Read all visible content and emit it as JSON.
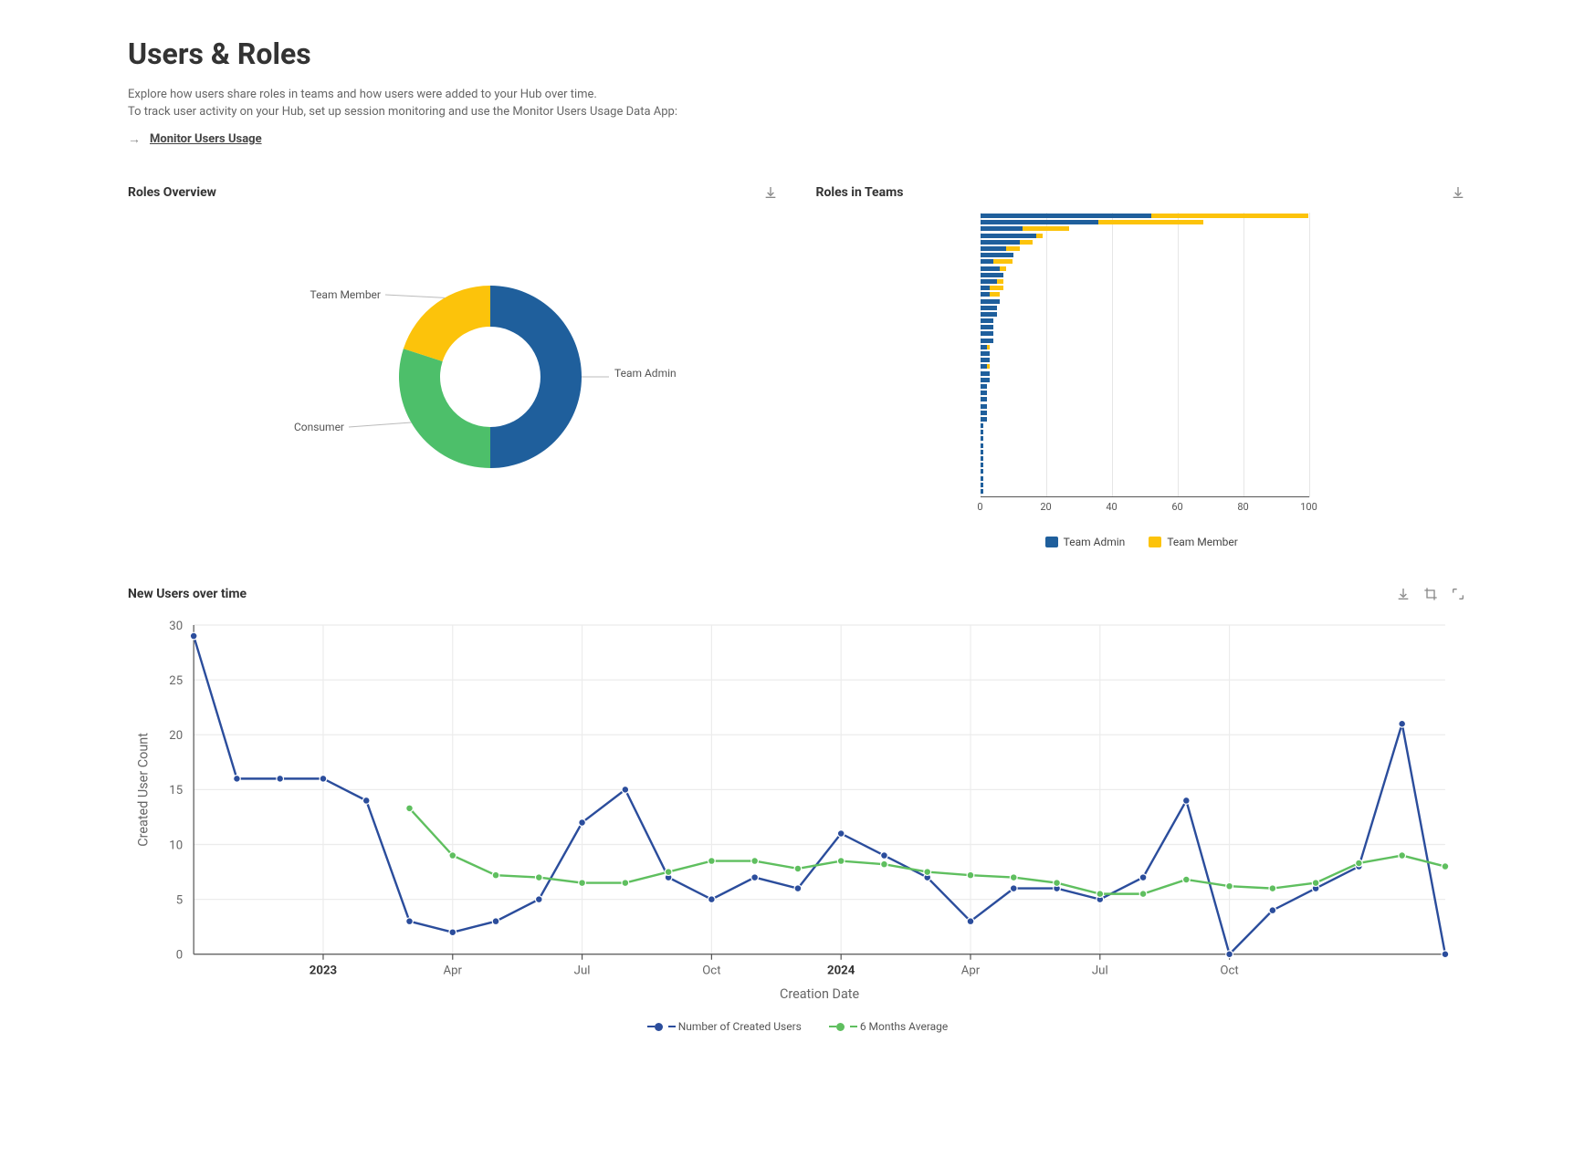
{
  "title": "Users & Roles",
  "intro": {
    "line1": "Explore how users share roles in teams and how users were added to your Hub over time.",
    "line2": "To track user activity on your Hub, set up session monitoring and use the Monitor Users Usage Data App:"
  },
  "link": {
    "label": "Monitor Users Usage"
  },
  "panels": {
    "roles_overview": {
      "title": "Roles Overview"
    },
    "roles_in_teams": {
      "title": "Roles in Teams"
    },
    "new_users": {
      "title": "New Users over time"
    }
  },
  "colors": {
    "team_admin": "#1f5f9c",
    "team_member": "#fcc30b",
    "consumer": "#4dbf6a",
    "line_created": "#2b4d9c",
    "line_avg": "#5fbf5f"
  },
  "chart_data": [
    {
      "id": "roles_overview_donut",
      "type": "pie",
      "title": "Roles Overview",
      "series": [
        {
          "name": "Team Admin",
          "value": 50
        },
        {
          "name": "Consumer",
          "value": 30
        },
        {
          "name": "Team Member",
          "value": 20
        }
      ],
      "hole": 0.55
    },
    {
      "id": "roles_in_teams_bar",
      "type": "bar",
      "orientation": "horizontal",
      "stacked": true,
      "title": "Roles in Teams",
      "xlabel": "",
      "xlim": [
        0,
        100
      ],
      "xticks": [
        0,
        20,
        40,
        60,
        80,
        100
      ],
      "legend": [
        "Team Admin",
        "Team Member"
      ],
      "rows": [
        {
          "team_admin": 52,
          "team_member": 48
        },
        {
          "team_admin": 36,
          "team_member": 32
        },
        {
          "team_admin": 13,
          "team_member": 14
        },
        {
          "team_admin": 17,
          "team_member": 2
        },
        {
          "team_admin": 12,
          "team_member": 4
        },
        {
          "team_admin": 8,
          "team_member": 4
        },
        {
          "team_admin": 10,
          "team_member": 0
        },
        {
          "team_admin": 4,
          "team_member": 6
        },
        {
          "team_admin": 6,
          "team_member": 2
        },
        {
          "team_admin": 7,
          "team_member": 0
        },
        {
          "team_admin": 5,
          "team_member": 2
        },
        {
          "team_admin": 3,
          "team_member": 4
        },
        {
          "team_admin": 3,
          "team_member": 3
        },
        {
          "team_admin": 6,
          "team_member": 0
        },
        {
          "team_admin": 5,
          "team_member": 0
        },
        {
          "team_admin": 5,
          "team_member": 0
        },
        {
          "team_admin": 4,
          "team_member": 0
        },
        {
          "team_admin": 4,
          "team_member": 0
        },
        {
          "team_admin": 4,
          "team_member": 0
        },
        {
          "team_admin": 4,
          "team_member": 0
        },
        {
          "team_admin": 2,
          "team_member": 1
        },
        {
          "team_admin": 3,
          "team_member": 0
        },
        {
          "team_admin": 3,
          "team_member": 0
        },
        {
          "team_admin": 2,
          "team_member": 1
        },
        {
          "team_admin": 3,
          "team_member": 0
        },
        {
          "team_admin": 3,
          "team_member": 0
        },
        {
          "team_admin": 2,
          "team_member": 0
        },
        {
          "team_admin": 2,
          "team_member": 0
        },
        {
          "team_admin": 2,
          "team_member": 0
        },
        {
          "team_admin": 2,
          "team_member": 0
        },
        {
          "team_admin": 2,
          "team_member": 0
        },
        {
          "team_admin": 2,
          "team_member": 0
        },
        {
          "team_admin": 1,
          "team_member": 0
        },
        {
          "team_admin": 1,
          "team_member": 0
        },
        {
          "team_admin": 1,
          "team_member": 0
        },
        {
          "team_admin": 1,
          "team_member": 0
        },
        {
          "team_admin": 1,
          "team_member": 0
        },
        {
          "team_admin": 1,
          "team_member": 0
        },
        {
          "team_admin": 1,
          "team_member": 0
        },
        {
          "team_admin": 1,
          "team_member": 0
        },
        {
          "team_admin": 1,
          "team_member": 0
        },
        {
          "team_admin": 1,
          "team_member": 0
        },
        {
          "team_admin": 1,
          "team_member": 0
        }
      ]
    },
    {
      "id": "new_users_line",
      "type": "line",
      "title": "New Users over time",
      "xlabel": "Creation Date",
      "ylabel": "Created User Count",
      "ylim": [
        0,
        30
      ],
      "yticks": [
        0,
        5,
        10,
        15,
        20,
        25,
        30
      ],
      "x": [
        "2022-10",
        "2022-11",
        "2022-12",
        "2023-01",
        "2023-02",
        "2023-03",
        "2023-04",
        "2023-05",
        "2023-06",
        "2023-07",
        "2023-08",
        "2023-09",
        "2023-10",
        "2023-11",
        "2023-12",
        "2024-01",
        "2024-02",
        "2024-03",
        "2024-04",
        "2024-05",
        "2024-06",
        "2024-07",
        "2024-08",
        "2024-09",
        "2024-10",
        "2024-11",
        "2024-12"
      ],
      "x_tick_labels": [
        "2023",
        "Apr",
        "Jul",
        "Oct",
        "2024",
        "Apr",
        "Jul",
        "Oct"
      ],
      "x_tick_indices": [
        3,
        6,
        9,
        12,
        15,
        18,
        21,
        24
      ],
      "x_tick_bold": [
        true,
        false,
        false,
        false,
        true,
        false,
        false,
        false
      ],
      "series": [
        {
          "name": "Number of Created Users",
          "values": [
            29,
            16,
            16,
            16,
            14,
            3,
            2,
            3,
            5,
            12,
            15,
            7,
            5,
            7,
            6,
            11,
            9,
            7,
            3,
            6,
            6,
            5,
            7,
            14,
            0,
            4,
            6,
            8,
            21,
            0
          ],
          "values_actual": [
            29,
            16,
            16,
            16,
            14,
            3,
            2,
            3,
            5,
            12,
            15,
            7,
            5,
            7,
            6,
            11,
            9,
            7,
            3,
            6,
            6,
            5,
            7,
            14,
            0,
            4,
            6,
            8,
            21,
            0
          ]
        },
        {
          "name": "6 Months Average",
          "values": [
            null,
            null,
            null,
            null,
            null,
            13.3,
            9.0,
            7.2,
            7.0,
            6.5,
            6.5,
            7.5,
            8.5,
            8.5,
            7.8,
            8.5,
            8.2,
            7.5,
            7.2,
            7.0,
            6.5,
            5.5,
            5.5,
            6.8,
            6.2,
            6.0,
            6.5,
            8.3,
            9.0,
            8.0
          ]
        }
      ],
      "legend_position": "bottom"
    }
  ],
  "legend_labels": {
    "team_admin": "Team Admin",
    "team_member": "Team Member",
    "consumer": "Consumer",
    "created": "Number of Created Users",
    "avg6": "6 Months Average"
  },
  "axis_labels": {
    "creation_date": "Creation Date",
    "created_user_count": "Created User Count"
  }
}
